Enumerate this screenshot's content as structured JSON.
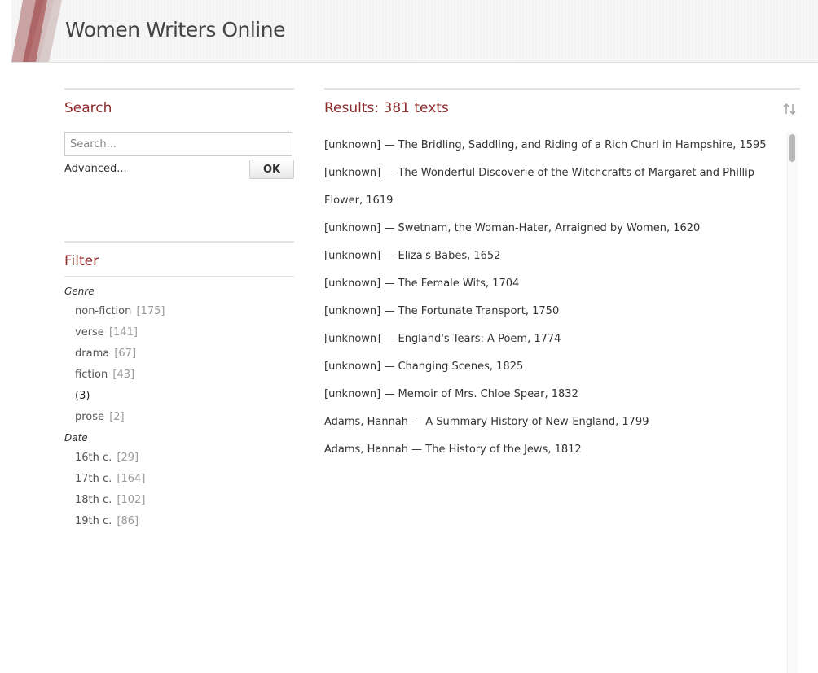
{
  "header": {
    "site_title": "Women Writers Online",
    "logo_icon": "wwo-logo-icon"
  },
  "search": {
    "title": "Search",
    "placeholder": "Search...",
    "advanced_label": "Advanced...",
    "ok_label": "OK"
  },
  "filter": {
    "title": "Filter",
    "genre": {
      "label": "Genre",
      "items": [
        {
          "name": "non-fiction",
          "count": "[175]"
        },
        {
          "name": "verse",
          "count": "[141]"
        },
        {
          "name": "drama",
          "count": "[67]"
        },
        {
          "name": "fiction",
          "count": "[43]"
        },
        {
          "name": "(3)",
          "count": ""
        },
        {
          "name": "prose",
          "count": "[2]"
        }
      ]
    },
    "date": {
      "label": "Date",
      "items": [
        {
          "name": "16th c.",
          "count": "[29]"
        },
        {
          "name": "17th c.",
          "count": "[164]"
        },
        {
          "name": "18th c.",
          "count": "[102]"
        },
        {
          "name": "19th c.",
          "count": "[86]"
        }
      ]
    }
  },
  "results": {
    "title": "Results: 381 texts",
    "sort_icon": "sort-arrows-icon",
    "items": [
      "[unknown] — The Bridling, Saddling, and Riding of a Rich Churl in Hampshire, 1595",
      "[unknown] — The Wonderful Discoverie of the Witchcrafts of Margaret and Phillip Flower, 1619",
      "[unknown] — Swetnam, the Woman-Hater, Arraigned by Women, 1620",
      "[unknown] — Eliza's Babes, 1652",
      "[unknown] — The Female Wits, 1704",
      "[unknown] — The Fortunate Transport, 1750",
      "[unknown] — England's Tears: A Poem, 1774",
      "[unknown] — Changing Scenes, 1825",
      "[unknown] — Memoir of Mrs. Chloe Spear, 1832",
      "Adams, Hannah — A Summary History of New-England, 1799",
      "Adams, Hannah — The History of the Jews, 1812"
    ]
  },
  "colors": {
    "accent": "#8b2b2b",
    "text": "#333333",
    "muted": "#999999"
  }
}
